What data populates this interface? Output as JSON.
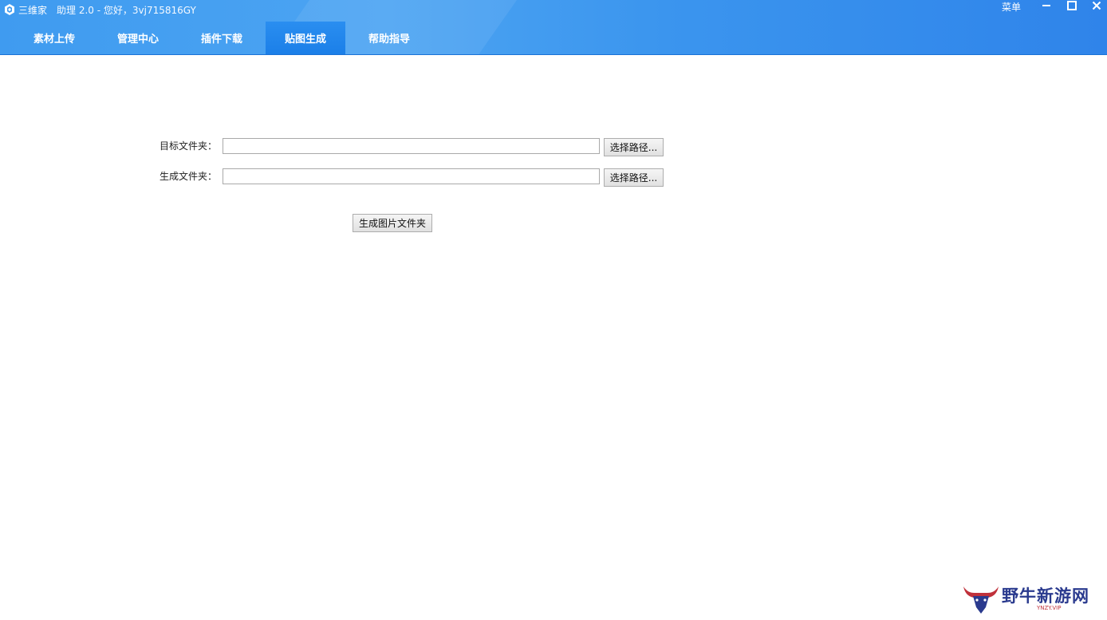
{
  "titlebar": {
    "brand": "三维家",
    "subtitle": "助理 2.0 - 您好，3vj715816GY",
    "menu_label": "菜单"
  },
  "tabs": [
    {
      "label": "素材上传",
      "active": false
    },
    {
      "label": "管理中心",
      "active": false
    },
    {
      "label": "插件下载",
      "active": false
    },
    {
      "label": "贴图生成",
      "active": true
    },
    {
      "label": "帮助指导",
      "active": false
    }
  ],
  "form": {
    "target_label": "目标文件夹：",
    "target_value": "",
    "output_label": "生成文件夹：",
    "output_value": "",
    "browse_label": "选择路径...",
    "generate_label": "生成图片文件夹"
  },
  "watermark": {
    "text": "野牛新游网",
    "sub": "YNZY.VIP"
  },
  "colors": {
    "titlebar": "#3f9bf0",
    "active_tab": "#1b7fe8",
    "watermark_text": "#2a3a8e",
    "watermark_accent": "#c0313b"
  }
}
